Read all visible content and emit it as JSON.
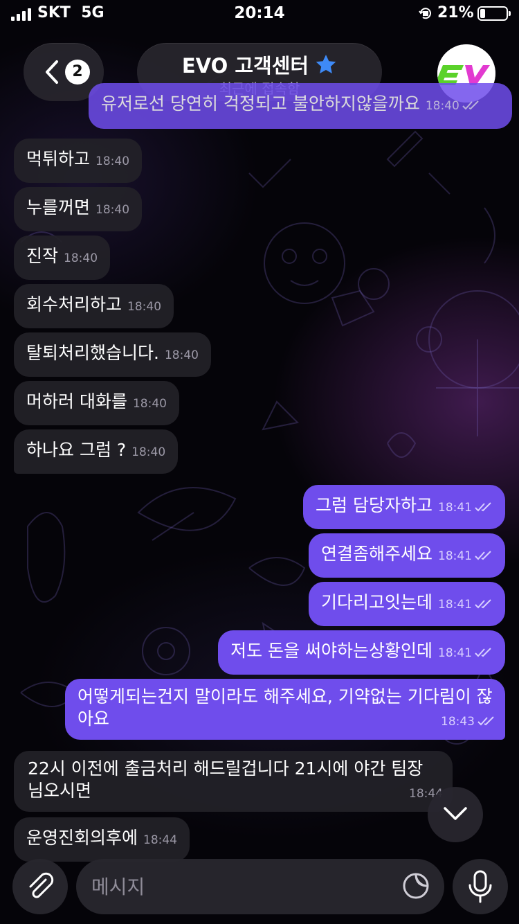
{
  "status_bar": {
    "carrier": "SKT",
    "network": "5G",
    "time": "20:14",
    "battery": "21%"
  },
  "header": {
    "back_count": "2",
    "title": "EVO 고객센터",
    "subtitle": "최근에 접속함",
    "avatar_text": "EV"
  },
  "messages": [
    {
      "dir": "out",
      "text": "유저로선 당연히 걱정되고 불안하지않을까요",
      "time": "18:40"
    },
    {
      "dir": "in",
      "text": "먹튀하고",
      "time": "18:40"
    },
    {
      "dir": "in",
      "text": "누를꺼면",
      "time": "18:40"
    },
    {
      "dir": "in",
      "text": "진작",
      "time": "18:40"
    },
    {
      "dir": "in",
      "text": "회수처리하고",
      "time": "18:40"
    },
    {
      "dir": "in",
      "text": "탈퇴처리했습니다.",
      "time": "18:40"
    },
    {
      "dir": "in",
      "text": "머하러 대화를",
      "time": "18:40"
    },
    {
      "dir": "in",
      "text": "하나요 그럼 ?",
      "time": "18:40"
    },
    {
      "dir": "out",
      "text": "그럼 담당자하고",
      "time": "18:41"
    },
    {
      "dir": "out",
      "text": "연결좀해주세요",
      "time": "18:41"
    },
    {
      "dir": "out",
      "text": "기다리고잇는데",
      "time": "18:41"
    },
    {
      "dir": "out",
      "text": "저도 돈을 써야하는상황인데",
      "time": "18:41"
    },
    {
      "dir": "out",
      "text": "어떻게되는건지 말이라도 해주세요, 기약없는 기다림이 잖아요",
      "time": "18:43"
    },
    {
      "dir": "in",
      "text": "22시 이전에 출금처리 해드릴겁니다 21시에 야간 팀장님오시면",
      "time": "18:44"
    },
    {
      "dir": "in",
      "text": "운영진회의후에",
      "time": "18:44"
    }
  ],
  "composer": {
    "placeholder": "메시지"
  },
  "colors": {
    "outgoing_bubble": "#6f4dec",
    "incoming_bubble": "#222128",
    "accent_star": "#3e8af7"
  },
  "icons": [
    "signal-icon",
    "lock-rotation-icon",
    "battery-icon",
    "back-chevron-icon",
    "star-icon",
    "chevron-down-icon",
    "paperclip-icon",
    "sticker-icon",
    "microphone-icon",
    "read-check-icon"
  ]
}
